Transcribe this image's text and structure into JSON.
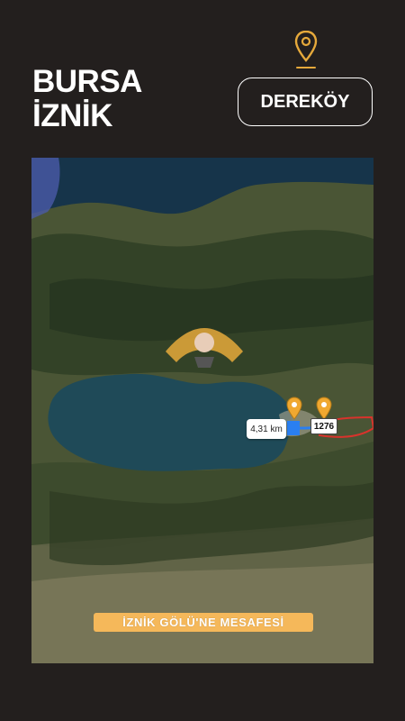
{
  "header": {
    "city_line1": "BURSA",
    "city_line2": "İZNİK",
    "location_button": "DEREKÖY",
    "location_icon": "map-pin-icon"
  },
  "map": {
    "distance_label": "4,31 km",
    "road_sign": "1276",
    "lake_color": "#1f4a58",
    "terrain_color": "#3d4a2f",
    "parcel_outline_color": "#d8332c",
    "route_color": "#2a7ff0"
  },
  "banner": {
    "text": "İZNİK GÖLÜ'NE MESAFESİ",
    "color": "#f5b85a"
  },
  "colors": {
    "background": "#231f1e",
    "accent": "#e6a93b"
  }
}
